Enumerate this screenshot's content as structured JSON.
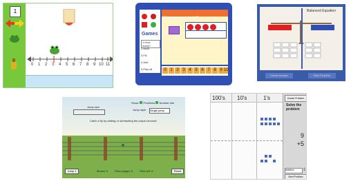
{
  "colors": {
    "green": "#78c83c",
    "blue": "#2f4fb3",
    "orange": "#f2a93a",
    "red": "#e02020"
  },
  "panel1": {
    "top_button": "1",
    "numbers": [
      "0",
      "1",
      "2",
      "3",
      "4",
      "5",
      "6",
      "7",
      "8",
      "9",
      "10",
      "11"
    ]
  },
  "panel2": {
    "prompt": "How many are empty?",
    "menu_title": "Games",
    "menu_items": [
      "1.How many?",
      "2.Build",
      "3.Fill",
      "4.Add",
      "5.Play all"
    ],
    "number_buttons": [
      "0",
      "1",
      "2",
      "3",
      "4",
      "5",
      "6",
      "7",
      "8",
      "9",
      "10"
    ]
  },
  "panel3": {
    "title": "Balanced Equation",
    "buttons": [
      "Check Answer",
      "Next Problem"
    ]
  },
  "panel4": {
    "top_options": [
      "Show:",
      "Problems",
      "Number line"
    ],
    "instructions": "Catch a fly by adding or subtracting the proper amount.",
    "jump_size_label": "Jump size",
    "jump_style_label": "Jump style",
    "jump_style_value": "Single jump",
    "bottom": [
      "Jump 1",
      "Moves: 0",
      "Flies caught: 0",
      "Flies left: 5",
      "Reset"
    ]
  },
  "panel5": {
    "headers": [
      "100's",
      "10's",
      "1's"
    ],
    "create_button": "Create Problem",
    "instruction": "Solve the problem",
    "number_top": "9",
    "number_bottom": "+5",
    "mode_value": "Addition",
    "next_button": "Next Problem"
  }
}
